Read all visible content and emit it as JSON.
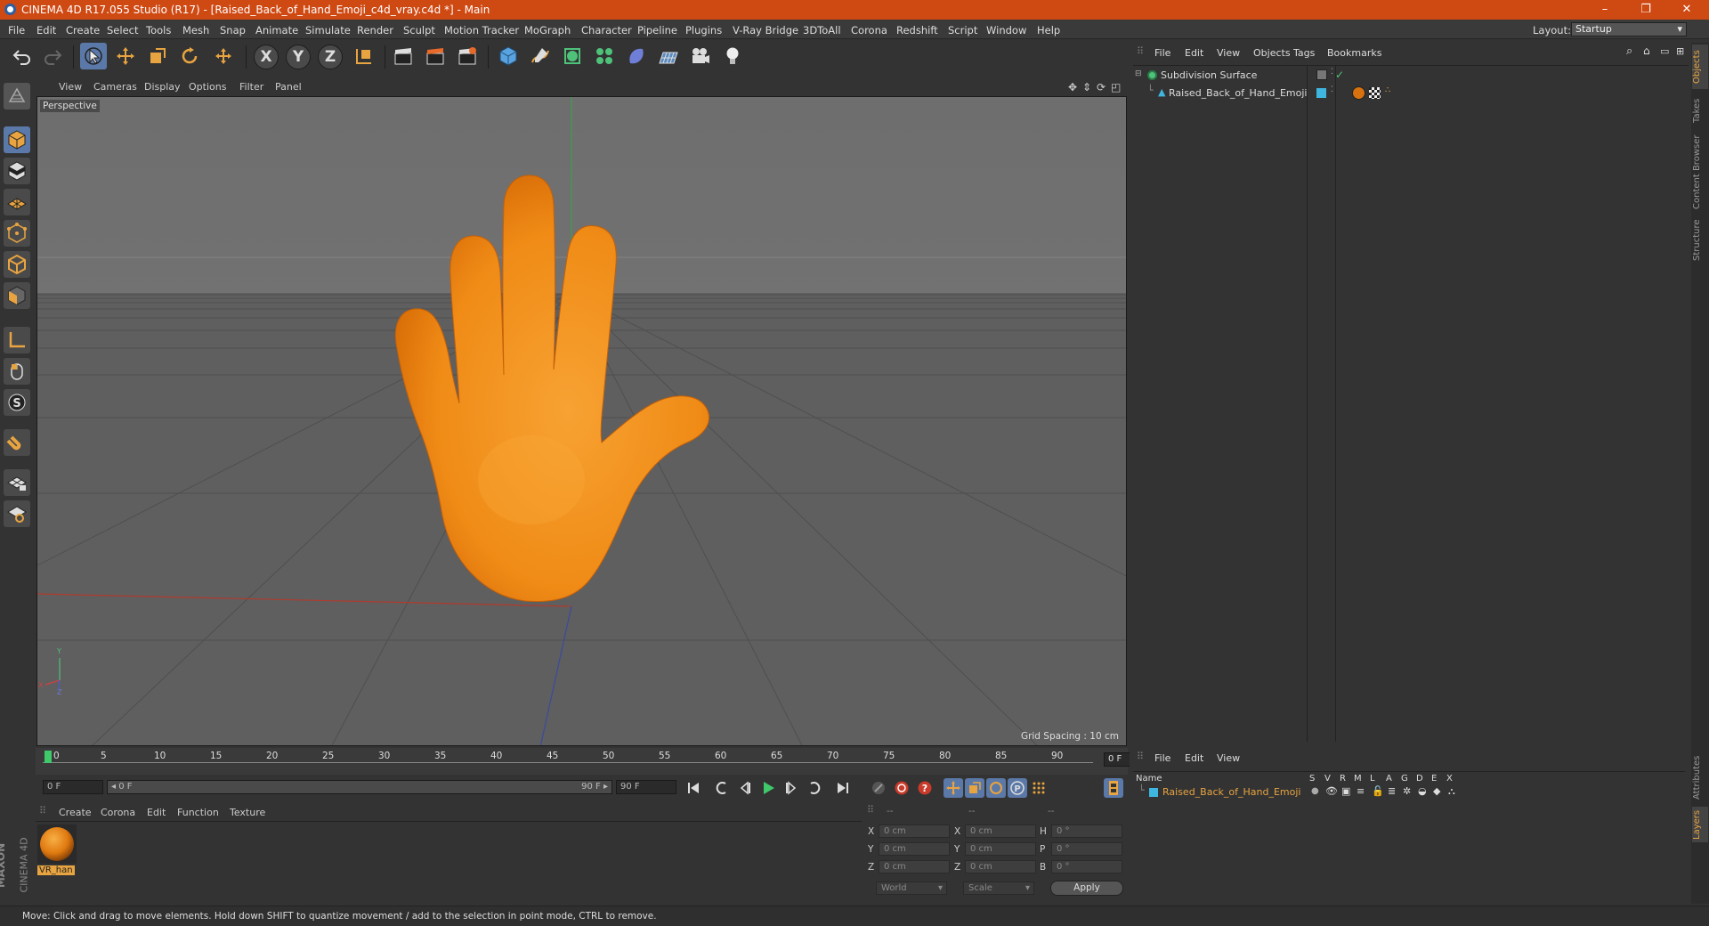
{
  "window": {
    "title": "CINEMA 4D R17.055 Studio (R17) - [Raised_Back_of_Hand_Emoji_c4d_vray.c4d *] - Main",
    "controls": [
      "–",
      "❐",
      "✕"
    ]
  },
  "menubar": {
    "items": [
      "File",
      "Edit",
      "Create",
      "Select",
      "Tools",
      "Mesh",
      "Snap",
      "Animate",
      "Simulate",
      "Render",
      "Sculpt",
      "Motion Tracker",
      "MoGraph",
      "Character",
      "Pipeline",
      "Plugins",
      "V-Ray Bridge",
      "3DToAll",
      "Corona",
      "Redshift",
      "Script",
      "Window",
      "Help"
    ],
    "layout_label": "Layout:",
    "layout_value": "Startup"
  },
  "toolbar": {
    "axis_x": "X",
    "axis_y": "Y",
    "axis_z": "Z"
  },
  "viewport": {
    "menu": [
      "View",
      "Cameras",
      "Display",
      "Options",
      "Filter",
      "Panel"
    ],
    "label": "Perspective",
    "grid_spacing": "Grid Spacing : 10 cm",
    "mini_axis_y": "Y",
    "mini_axis_x": "X",
    "mini_axis_z": "Z"
  },
  "timeline": {
    "ticks": [
      "0",
      "5",
      "10",
      "15",
      "20",
      "25",
      "30",
      "35",
      "40",
      "45",
      "50",
      "55",
      "60",
      "65",
      "70",
      "75",
      "80",
      "85",
      "90"
    ],
    "current_frame": "0 F",
    "start_field": "0 F",
    "range_start": "◂ 0 F",
    "range_end": "90 F ▸",
    "end_field": "90 F"
  },
  "material_manager": {
    "menu": [
      "Create",
      "Corona",
      "Edit",
      "Function",
      "Texture"
    ],
    "materials": [
      {
        "name": "VR_han"
      }
    ]
  },
  "coordinates": {
    "headers": [
      "--",
      "--",
      "--"
    ],
    "rows": [
      {
        "a": "X",
        "pos": "0 cm",
        "b": "X",
        "size": "0 cm",
        "c": "H",
        "rot": "0 °"
      },
      {
        "a": "Y",
        "pos": "0 cm",
        "b": "Y",
        "size": "0 cm",
        "c": "P",
        "rot": "0 °"
      },
      {
        "a": "Z",
        "pos": "0 cm",
        "b": "Z",
        "size": "0 cm",
        "c": "B",
        "rot": "0 °"
      }
    ],
    "mode": "World",
    "scale": "Scale",
    "apply": "Apply"
  },
  "object_manager": {
    "menu": [
      "File",
      "Edit",
      "View",
      "Objects",
      "Tags",
      "Bookmarks"
    ],
    "objects": [
      {
        "name": "Subdivision Surface"
      },
      {
        "name": "Raised_Back_of_Hand_Emoji"
      }
    ]
  },
  "layer_manager": {
    "menu": [
      "File",
      "Edit",
      "View"
    ],
    "col_name": "Name",
    "cols": [
      "S",
      "V",
      "R",
      "M",
      "L",
      "A",
      "G",
      "D",
      "E",
      "X"
    ],
    "layers": [
      {
        "name": "Raised_Back_of_Hand_Emoji",
        "color": "#3fb6e0"
      }
    ]
  },
  "side_tabs": {
    "top": [
      "Objects",
      "Takes",
      "Content Browser",
      "Structure"
    ],
    "bottom": [
      "Attributes",
      "Layers"
    ]
  },
  "branding": {
    "line1": "MAXON",
    "line2": "CINEMA 4D"
  },
  "status": "Move: Click and drag to move elements. Hold down SHIFT to quantize movement / add to the selection in point mode, CTRL to remove.",
  "colors": {
    "accent": "#cf4913",
    "selection": "#5b79a8",
    "object_orange": "#e8a440",
    "hand": "#f28a17"
  }
}
